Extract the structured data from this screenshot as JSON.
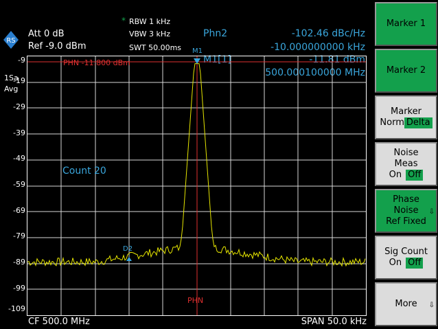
{
  "header": {
    "att": "Att  0 dB",
    "ref": "Ref -9.0 dBm",
    "rbw": "RBW  1 kHz",
    "vbw": "VBW  3 kHz",
    "swt": "SWT  50.00ms",
    "rbw_star": "*",
    "phn_label": "Phn2",
    "phn_value": "-102.46 dBc/Hz",
    "phn_offset": "-10.000000000 kHz",
    "m1_label": "M1[1]",
    "m1_level": "-11.81 dBm",
    "m1_freq": "500.000100000 MHz"
  },
  "left": {
    "line1": "1Sa",
    "line2": "Avg"
  },
  "plot": {
    "ref_line_label": "PHN -11.800 dBm",
    "count_label": "Count 20",
    "marker_m1": "M1",
    "marker_d2": "D2",
    "phn_bottom": "PHN",
    "y_ticks": [
      "-9",
      "-19",
      "-29",
      "-39",
      "-49",
      "-59",
      "-69",
      "-79",
      "-89",
      "-99",
      "-109"
    ],
    "cf": "CF 500.0 MHz",
    "span": "SPAN 50.0 kHz",
    "colors": {
      "trace": "#e6e600",
      "marker": "#3aa6dc",
      "phn": "#e03030",
      "grid": "#ffffff"
    }
  },
  "softkeys": {
    "marker1": "Marker 1",
    "marker2": "Marker 2",
    "marker": "Marker",
    "norm": "Norm",
    "delta": "Delta",
    "noise": "Noise",
    "meas": "Meas",
    "on": "On",
    "off": "Off",
    "phase": "Phase",
    "noise2": "Noise",
    "ref_fixed": "Ref Fixed",
    "sig_count": "Sig Count",
    "on2": "On",
    "off2": "Off",
    "more": "More",
    "more_icon": "chevron-down-icon"
  }
}
